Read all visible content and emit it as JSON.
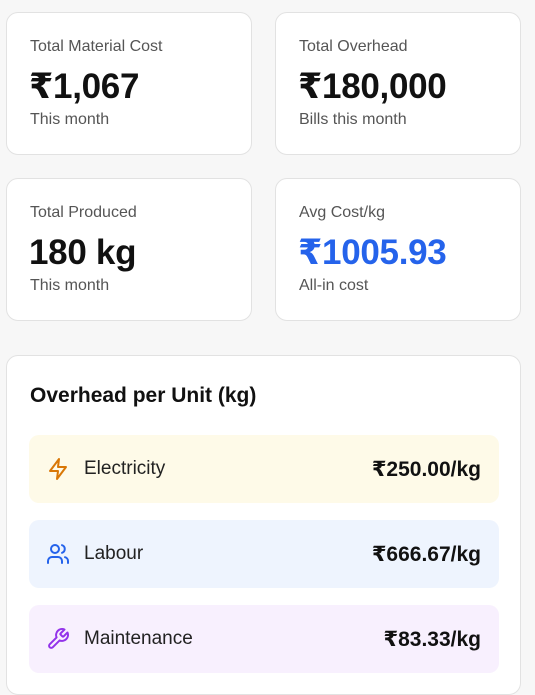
{
  "stats": [
    {
      "label": "Total Material Cost",
      "value": "₹1,067",
      "sub": "This month"
    },
    {
      "label": "Total Overhead",
      "value": "₹180,000",
      "sub": "Bills this month"
    },
    {
      "label": "Total Produced",
      "value": "180 kg",
      "sub": "This month"
    },
    {
      "label": "Avg Cost/kg",
      "value": "₹1005.93",
      "sub": "All-in cost",
      "color": "#2563eb"
    }
  ],
  "overhead": {
    "title": "Overhead per Unit (kg)",
    "items": [
      {
        "label": "Electricity",
        "value": "₹250.00/kg",
        "icon": "lightning-bolt-icon",
        "color": "#fefae8",
        "icon_color": "#d97706"
      },
      {
        "label": "Labour",
        "value": "₹666.67/kg",
        "icon": "users-icon",
        "color": "#eef4fe",
        "icon_color": "#2563eb"
      },
      {
        "label": "Maintenance",
        "value": "₹83.33/kg",
        "icon": "wrench-icon",
        "color": "#f8f0fe",
        "icon_color": "#9333ea"
      }
    ]
  }
}
